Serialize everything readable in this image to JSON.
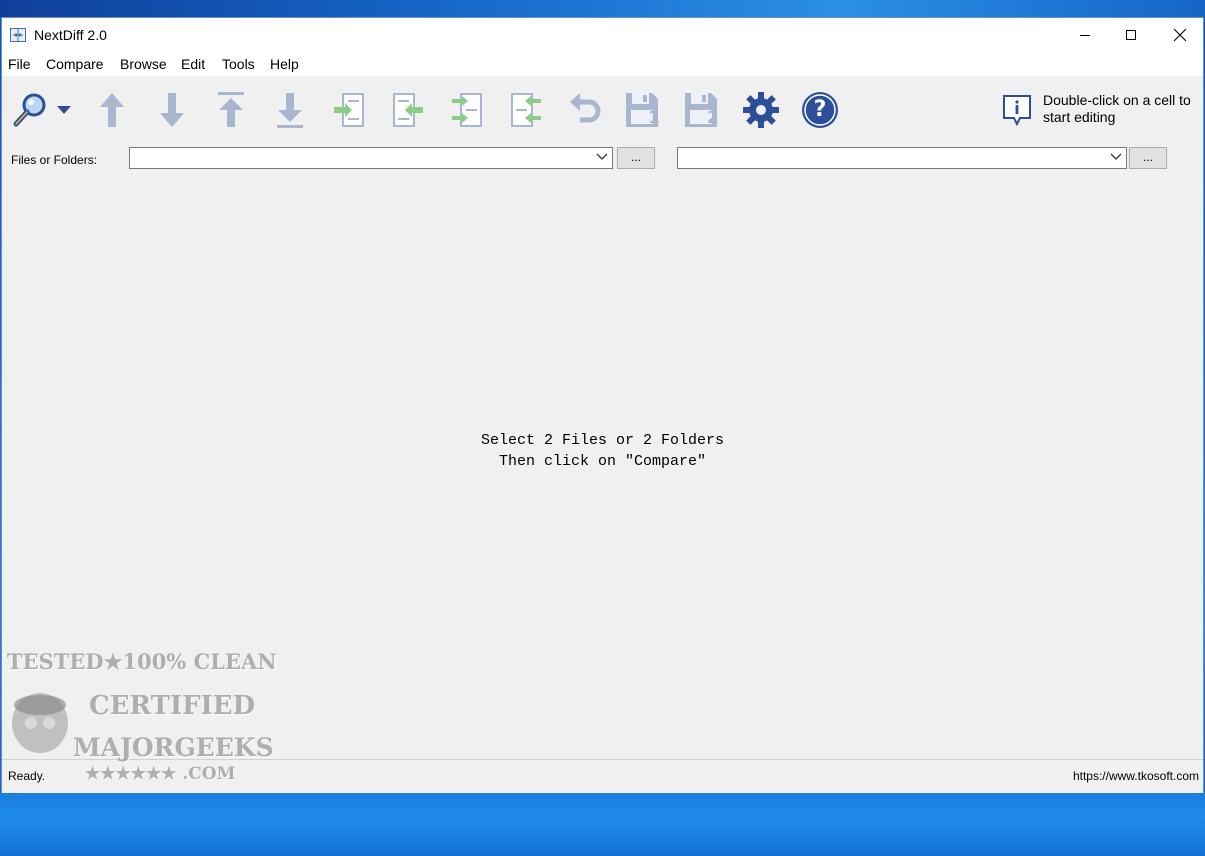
{
  "window": {
    "title": "NextDiff 2.0"
  },
  "menu": {
    "items": [
      "File",
      "Compare",
      "Browse",
      "Edit",
      "Tools",
      "Help"
    ]
  },
  "toolbar": {
    "buttons": [
      "compare-magnifier-icon",
      "dropdown-arrow-icon",
      "move-up-icon",
      "move-down-icon",
      "move-top-icon",
      "move-bottom-icon",
      "copy-right-icon",
      "copy-left-icon",
      "copy-all-right-icon",
      "copy-all-left-icon",
      "undo-icon",
      "save-left-icon",
      "save-right-icon",
      "settings-icon",
      "help-icon"
    ],
    "save_left_number": "1",
    "save_right_number": "2",
    "help_symbol": "?"
  },
  "info": {
    "line1": "Double-click on a cell to",
    "line2": "start editing"
  },
  "paths": {
    "label": "Files or Folders:",
    "left_value": "",
    "right_value": "",
    "browse_label": "..."
  },
  "content": {
    "hint_line1": "Select 2 Files or 2 Folders",
    "hint_line2": "Then click on \"Compare\""
  },
  "status": {
    "left": "Ready.",
    "right": "https://www.tkosoft.com"
  },
  "watermark": {
    "line1": "TESTED★100% CLEAN",
    "line2": "CERTIFIED",
    "line3": "MAJORGEEKS",
    "line4": "★★★★★★ .COM"
  },
  "colors": {
    "icon_gray": "#9aa8c6",
    "icon_green": "#9fd39a",
    "icon_blue": "#2d4f9a",
    "accent": "#1a7ddc"
  }
}
